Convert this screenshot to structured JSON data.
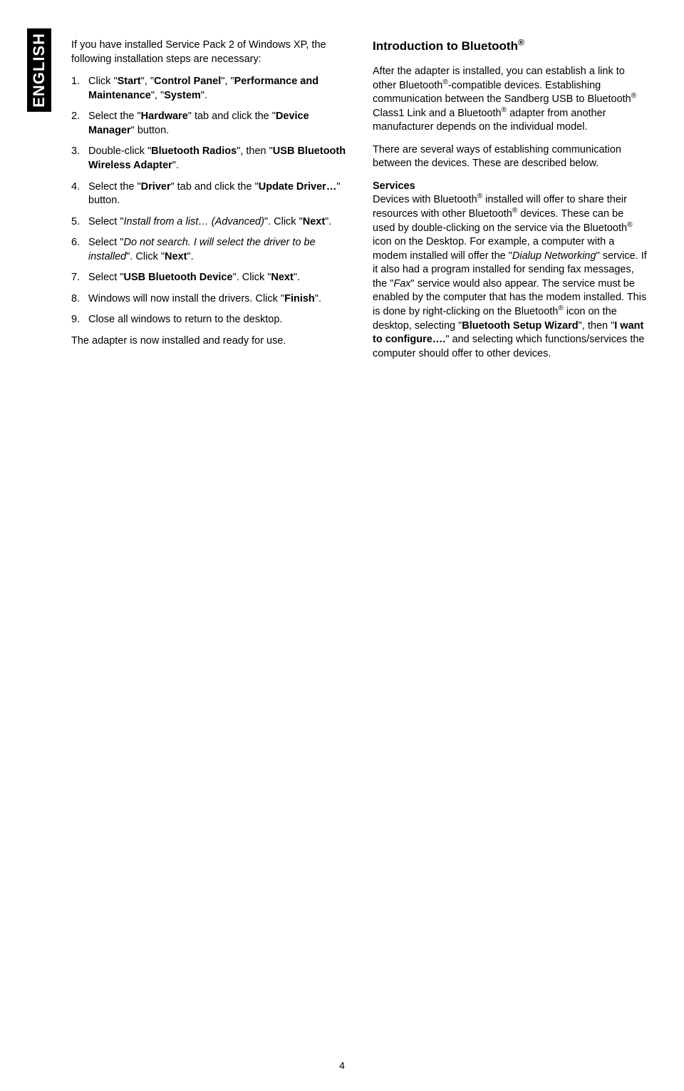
{
  "langTab": "ENGLISH",
  "pageNumber": "4",
  "left": {
    "intro": "If you have installed Service Pack 2 of Windows XP, the following installation steps are necessary:",
    "steps": [
      {
        "pre": "Click \"",
        "b1": "Start",
        "mid1": "\", \"",
        "b2": "Control Panel",
        "mid2": "\", \"",
        "b3": "Performance and Maintenance",
        "mid3": "\", \"",
        "b4": "System",
        "post": "\"."
      },
      {
        "pre": "Select the \"",
        "b1": "Hardware",
        "mid1": "\" tab and click the \"",
        "b2": "Device Manager",
        "post": "\" button."
      },
      {
        "pre": "Double-click \"",
        "b1": "Bluetooth Radios",
        "mid1": "\", then \"",
        "b2": "USB Bluetooth Wireless Adapter",
        "post": "\"."
      },
      {
        "pre": "Select the \"",
        "b1": "Driver",
        "mid1": "\" tab and click the \"",
        "b2": "Update Driver…",
        "post": "\" button."
      },
      {
        "pre": "Select \"",
        "i1": "Install from a list… (Advanced)",
        "mid1": "\". Click \"",
        "b1": "Next",
        "post": "\"."
      },
      {
        "pre": "Select \"",
        "i1": "Do not search. I will select the driver to be installed",
        "mid1": "\". Click \"",
        "b1": "Next",
        "post": "\"."
      },
      {
        "pre": "Select \"",
        "b1": "USB Bluetooth Device",
        "mid1": "\". Click \"",
        "b2": "Next",
        "post": "\"."
      },
      {
        "pre": "Windows will now install the drivers. Click \"",
        "b1": "Finish",
        "post": "\"."
      },
      {
        "pre": "Close all windows to return to the desktop."
      }
    ],
    "outro": "The adapter is now installed and ready for use."
  },
  "right": {
    "title": "Introduction to Bluetooth",
    "reg": "®",
    "p1a": "After the adapter is installed, you can establish a link to other Bluetooth",
    "p1b": "-compatible devices. Establishing communication between the Sandberg USB to Bluetooth",
    "p1c": " Class1 Link and a Bluetooth",
    "p1d": " adapter from another manufacturer depends on the individual model.",
    "p2": "There are several ways of establishing communication between the devices. These are described below.",
    "servicesLabel": "Services",
    "p3a": "Devices with Bluetooth",
    "p3b": " installed will offer to share their resources with other Bluetooth",
    "p3c": " devices. These can be used by double-clicking on the service via the Bluetooth",
    "p3d": " icon on the Desktop. For example, a computer with a modem installed will offer the \"",
    "p3e": "Dialup Networking",
    "p3f": "\" service. If it also had a program installed for sending fax messages, the \"",
    "p3g": "Fax",
    "p3h": "\" service would also appear. The service must be enabled by the computer that has the modem installed. This is done by right-clicking on the Bluetooth",
    "p3i": " icon on the desktop, selecting \"",
    "p3j": "Bluetooth Setup Wizard",
    "p3k": "\", then \"",
    "p3l": "I want to configure….",
    "p3m": "\" and selecting which functions/services the computer should offer to other devices."
  }
}
